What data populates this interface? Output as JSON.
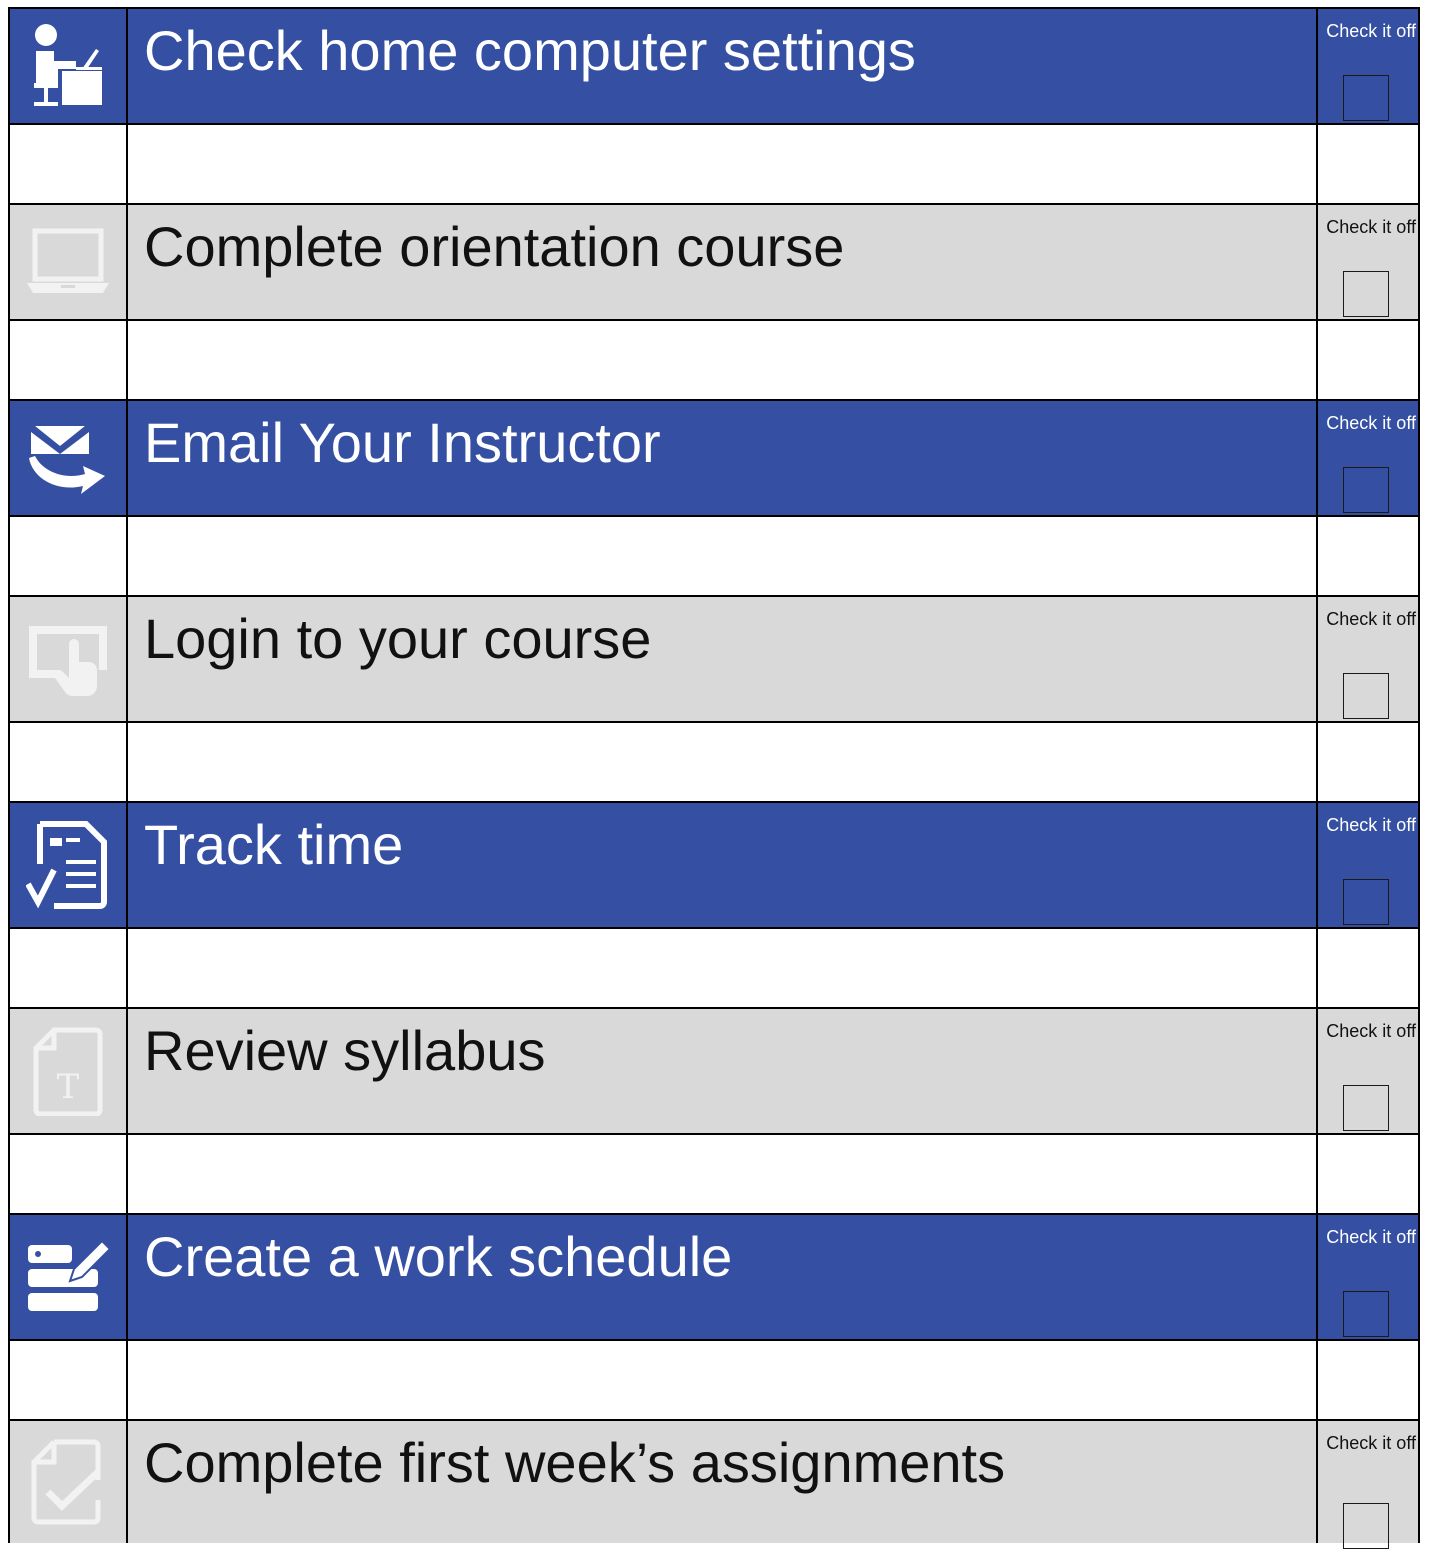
{
  "checklist": {
    "check_label": "Check it off",
    "items": [
      {
        "title": "Check home computer settings",
        "icon": "person-at-desk-icon",
        "theme": "blue",
        "checked": false
      },
      {
        "title": "Complete orientation course",
        "icon": "laptop-icon",
        "theme": "gray",
        "checked": false
      },
      {
        "title": "Email Your Instructor",
        "icon": "email-send-icon",
        "theme": "blue",
        "checked": false
      },
      {
        "title": "Login to your course",
        "icon": "touch-screen-icon",
        "theme": "gray",
        "checked": false
      },
      {
        "title": "Track time",
        "icon": "checklist-document-icon",
        "theme": "blue",
        "checked": false
      },
      {
        "title": "Review syllabus",
        "icon": "text-document-icon",
        "theme": "gray",
        "checked": false
      },
      {
        "title": "Create a work schedule",
        "icon": "edit-list-icon",
        "theme": "blue",
        "checked": false
      },
      {
        "title": "Complete first week’s assignments",
        "icon": "document-check-icon",
        "theme": "gray",
        "checked": false
      }
    ]
  },
  "colors": {
    "blue_row": "#3550a2",
    "gray_row": "#d9d9d9",
    "spacer_row": "#ffffff",
    "grid_line": "#000000"
  }
}
